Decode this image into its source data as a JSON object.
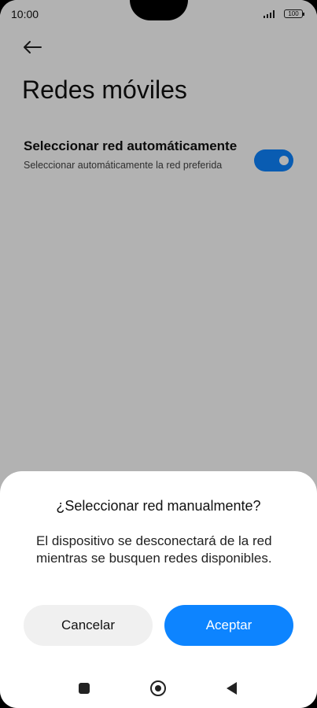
{
  "status_bar": {
    "time": "10:00",
    "battery": "100",
    "signal_icon": "signal-icon",
    "battery_icon": "battery-icon"
  },
  "page": {
    "back_icon": "back-arrow-icon",
    "title": "Redes móviles",
    "setting": {
      "title": "Seleccionar red automáticamente",
      "subtitle": "Seleccionar automáticamente la red preferida",
      "toggle_on": true
    }
  },
  "dialog": {
    "title": "¿Seleccionar red manualmente?",
    "message": "El dispositivo se desconectará de la red mientras se busquen redes disponibles.",
    "cancel_label": "Cancelar",
    "accept_label": "Aceptar"
  },
  "nav": {
    "recents_icon": "square-icon",
    "home_icon": "circle-icon",
    "back_icon": "triangle-back-icon"
  },
  "colors": {
    "accent": "#0d84ff",
    "scrim": "rgba(0,0,0,0.3)",
    "cancel_bg": "#f0f0f0"
  }
}
